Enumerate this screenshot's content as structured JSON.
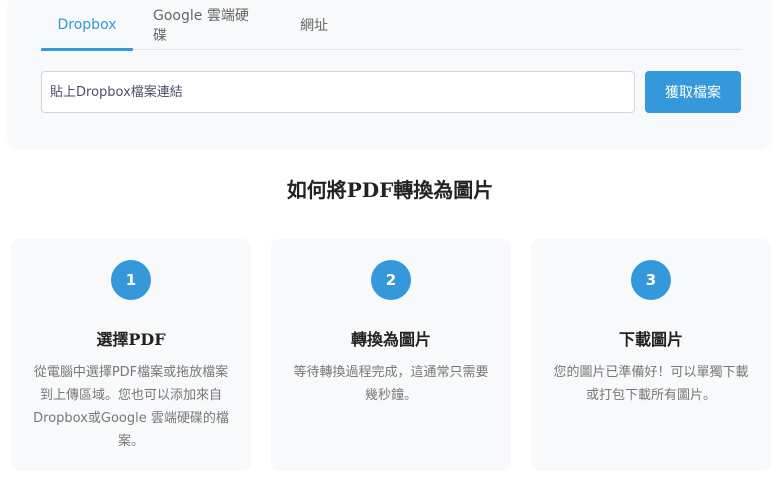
{
  "tabs": [
    {
      "label": "Dropbox",
      "active": true
    },
    {
      "label": "Google 雲端硬碟",
      "active": false
    },
    {
      "label": "網址",
      "active": false
    }
  ],
  "import": {
    "placeholder": "貼上Dropbox檔案連結",
    "fetch_label": "獲取檔案"
  },
  "how_to": {
    "title": "如何將PDF轉換為圖片",
    "steps": [
      {
        "number": "1",
        "title": "選擇PDF",
        "description": "從電腦中選擇PDF檔案或拖放檔案到上傳區域。您也可以添加來自Dropbox或Google 雲端硬碟的檔案。"
      },
      {
        "number": "2",
        "title": "轉換為圖片",
        "description": "等待轉換過程完成，這通常只需要幾秒鐘。"
      },
      {
        "number": "3",
        "title": "下載圖片",
        "description": "您的圖片已準備好！可以單獨下載或打包下載所有圖片。"
      }
    ]
  },
  "colors": {
    "accent": "#3498db",
    "card_bg": "#f7f9fb"
  }
}
